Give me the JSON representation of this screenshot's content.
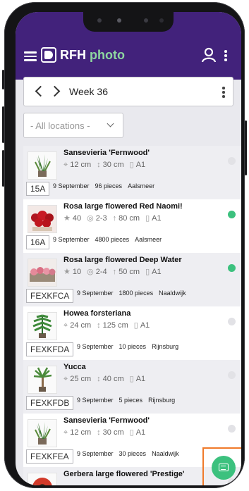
{
  "app": {
    "brand_left": "RFH",
    "brand_right": "photo"
  },
  "week": {
    "label": "Week 36"
  },
  "filter": {
    "location_label": "- All locations -"
  },
  "colors": {
    "header": "#42227b",
    "accent": "#3cc17e",
    "status_active": "#3cc17e",
    "status_inactive": "#e2e2e6",
    "highlight": "#f07a2a"
  },
  "items": [
    {
      "name": "Sansevieria 'Fernwood'",
      "specs": [
        {
          "icon": "pot-icon",
          "text": "12 cm"
        },
        {
          "icon": "height-icon",
          "text": "30 cm"
        },
        {
          "icon": "quality-icon",
          "text": "A1"
        }
      ],
      "code": "15A",
      "date": "9 September",
      "pieces": "96 pieces",
      "location": "Aalsmeer",
      "status": "inactive",
      "thumb": "plant-sansevieria-icon"
    },
    {
      "name": "Rosa large flowered Red Naomi!",
      "specs": [
        {
          "icon": "rank-icon",
          "text": "40"
        },
        {
          "icon": "maturity-icon",
          "text": "2-3"
        },
        {
          "icon": "stem-length-icon",
          "text": "80 cm"
        },
        {
          "icon": "quality-icon",
          "text": "A1"
        }
      ],
      "code": "16A",
      "date": "9 September",
      "pieces": "4800 pieces",
      "location": "Aalsmeer",
      "status": "active",
      "thumb": "flower-rose-red-icon"
    },
    {
      "name": "Rosa large flowered Deep Water",
      "specs": [
        {
          "icon": "rank-icon",
          "text": "10"
        },
        {
          "icon": "maturity-icon",
          "text": "2-4"
        },
        {
          "icon": "stem-length-icon",
          "text": "50 cm"
        },
        {
          "icon": "quality-icon",
          "text": "A1"
        }
      ],
      "code": "FEXKFCA",
      "date": "9 September",
      "pieces": "1800 pieces",
      "location": "Naaldwijk",
      "status": "active",
      "thumb": "flower-rose-pink-icon"
    },
    {
      "name": "Howea forsteriana",
      "specs": [
        {
          "icon": "pot-icon",
          "text": "24 cm"
        },
        {
          "icon": "height-icon",
          "text": "125 cm"
        },
        {
          "icon": "quality-icon",
          "text": "A1"
        }
      ],
      "code": "FEXKFDA",
      "date": "9 September",
      "pieces": "10 pieces",
      "location": "Rijnsburg",
      "status": "inactive",
      "thumb": "plant-palm-icon"
    },
    {
      "name": "Yucca",
      "specs": [
        {
          "icon": "pot-icon",
          "text": "25 cm"
        },
        {
          "icon": "height-icon",
          "text": "40 cm"
        },
        {
          "icon": "quality-icon",
          "text": "A1"
        }
      ],
      "code": "FEXKFDB",
      "date": "9 September",
      "pieces": "5 pieces",
      "location": "Rijnsburg",
      "status": "inactive",
      "thumb": "plant-yucca-icon"
    },
    {
      "name": "Sansevieria 'Fernwood'",
      "specs": [
        {
          "icon": "pot-icon",
          "text": "12 cm"
        },
        {
          "icon": "height-icon",
          "text": "30 cm"
        },
        {
          "icon": "quality-icon",
          "text": "A1"
        }
      ],
      "code": "FEXKFEA",
      "date": "9 September",
      "pieces": "30 pieces",
      "location": "Naaldwijk",
      "status": "inactive",
      "thumb": "plant-sansevieria-icon"
    },
    {
      "name": "Gerbera large flowered 'Prestige'",
      "specs": [],
      "code": "",
      "date": "",
      "pieces": "",
      "location": "",
      "status": "inactive",
      "thumb": "flower-gerbera-icon"
    }
  ],
  "fab": {
    "icon": "scan-icon"
  }
}
